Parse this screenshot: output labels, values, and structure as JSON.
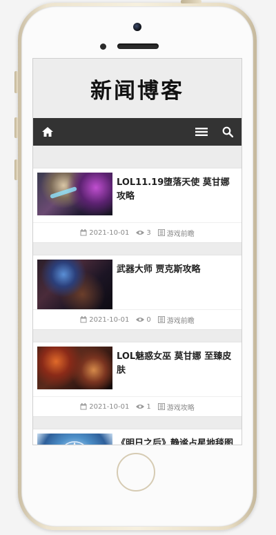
{
  "site": {
    "title": "新闻博客"
  },
  "nav": {
    "home_icon": "home-icon",
    "menu_icon": "hamburger-menu-icon",
    "search_icon": "search-icon"
  },
  "articles": [
    {
      "title": "LOL11.19堕落天使 莫甘娜攻略",
      "date": "2021-10-01",
      "views": "3",
      "category": "游戏前瞻"
    },
    {
      "title": "武器大师 贾克斯攻略",
      "date": "2021-10-01",
      "views": "0",
      "category": "游戏前瞻"
    },
    {
      "title": "LOL魅惑女巫 莫甘娜 至臻皮肤",
      "date": "2021-10-01",
      "views": "1",
      "category": "游戏攻略"
    },
    {
      "title": "《明日之后》静谧占星地毯图文展示",
      "date": "",
      "views": "",
      "category": ""
    }
  ],
  "colors": {
    "navbar": "#333333",
    "header_bg": "#ededed",
    "meta_text": "#888888"
  }
}
